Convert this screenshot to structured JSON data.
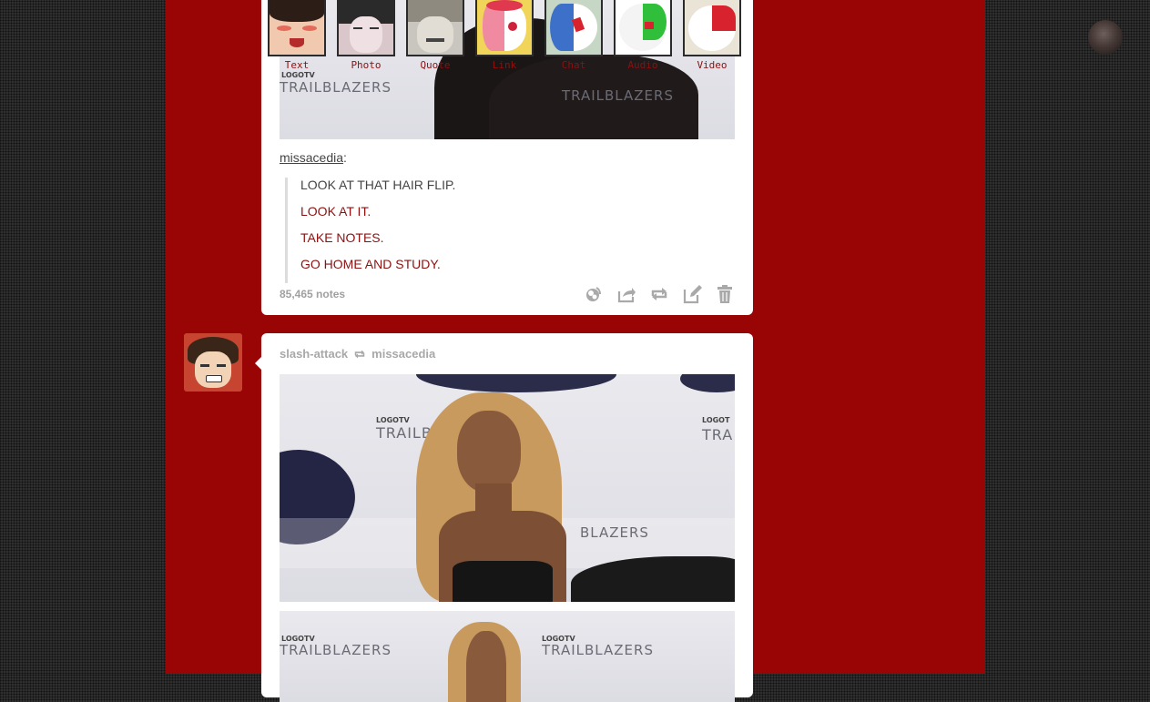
{
  "post_type_bar": [
    {
      "label": "Text",
      "icon": "crying-boy-icon"
    },
    {
      "label": "Photo",
      "icon": "dark-haired-man-icon"
    },
    {
      "label": "Quote",
      "icon": "grinning-man-icon"
    },
    {
      "label": "Link",
      "icon": "pink-bear-icon"
    },
    {
      "label": "Chat",
      "icon": "blue-bear-icon"
    },
    {
      "label": "Audio",
      "icon": "green-bear-icon"
    },
    {
      "label": "Video",
      "icon": "red-bear-icon"
    }
  ],
  "post1": {
    "photo_logo_left": "TRAILBLAZERS",
    "photo_logo_right": "TRAILBLAZERS",
    "photo_logo_small": "LOGOTV",
    "source_user": "missacedia",
    "quote_lines": [
      {
        "text": "LOOK AT THAT HAIR FLIP.",
        "tone": "dark"
      },
      {
        "text": "LOOK AT IT.",
        "tone": "red"
      },
      {
        "text": "TAKE NOTES.",
        "tone": "red"
      },
      {
        "text": "GO HOME AND STUDY.",
        "tone": "red"
      }
    ],
    "notes": "85,465 notes",
    "controls": [
      "like-icon",
      "share-icon",
      "reblog-icon",
      "edit-icon",
      "delete-icon"
    ]
  },
  "post2": {
    "reblogger": "slash-attack",
    "origin": "missacedia",
    "photo1_logo_small": "LOGOTV",
    "photo1_logo_left": "TRAILBLAZ",
    "photo1_logo_right_small": "LOGOT",
    "photo1_logo_right": "TRA",
    "photo1_logo_mid": "BLAZERS",
    "photo2_logo_left_small": "LOGOTV",
    "photo2_logo_left": "TRAILBLAZERS",
    "photo2_logo_right_small": "LOGOTV",
    "photo2_logo_right": "TRAILBLAZERS"
  },
  "colors": {
    "background": "#2f2f2f",
    "column": "#990404",
    "accent_red": "#8d1010"
  }
}
